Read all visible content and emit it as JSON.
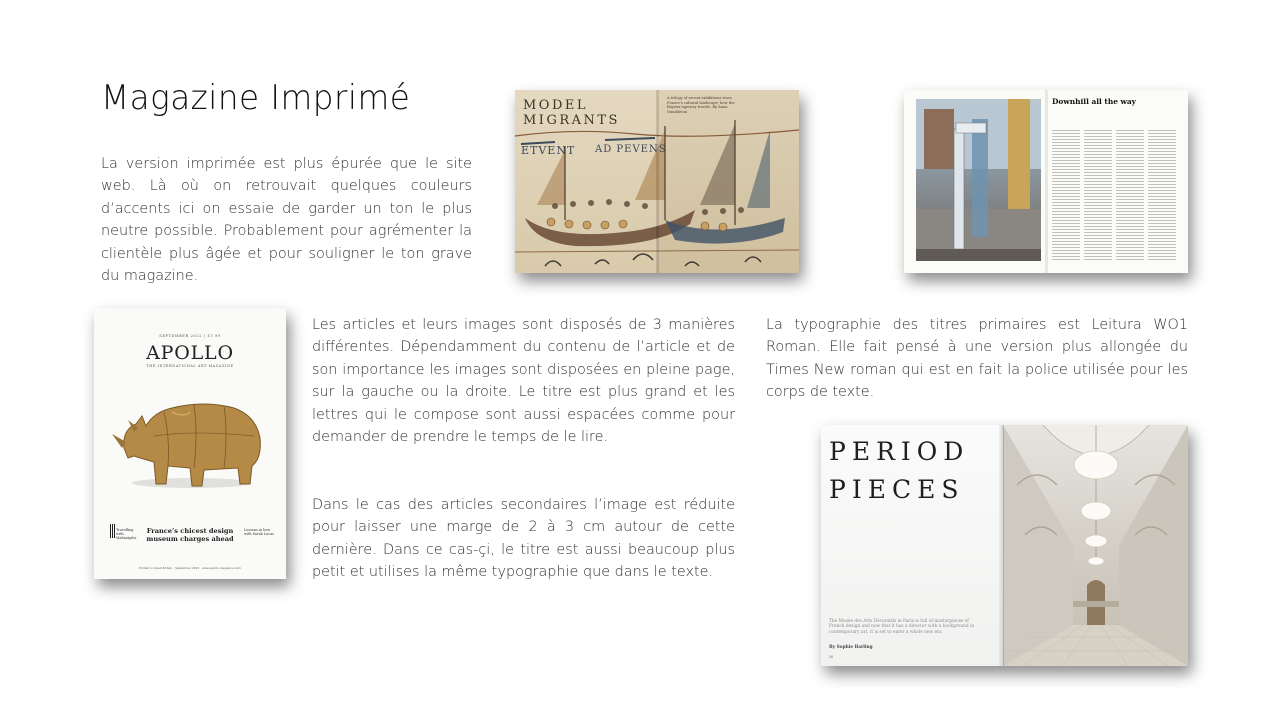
{
  "slide": {
    "title": "Magazine Imprimé",
    "paragraphs": {
      "intro": "La version imprimée est plus épurée que le site web. Là où on retrouvait quelques couleurs d’accents ici on essaie de garder un ton le plus neutre possible. Probablement pour agrémenter la clientèle plus âgée et pour souligner le ton grave du magazine.",
      "layouts": "Les articles et leurs images sont disposés de 3 manières différentes. Dépendamment du contenu de l’article et de son importance les images sont disposées en pleine page, sur la gauche ou la droite. Le titre est plus grand et les lettres qui le compose sont aussi espacées comme pour demander de prendre le temps de le lire.",
      "secondary": "Dans le cas des articles secondaires l’image est réduite pour laisser une marge de 2 à 3 cm autour de cette dernière. Dans ce cas-çi, le titre est aussi beaucoup plus petit et utilises la même typographie que dans le texte.",
      "typography": "La typographie des titres primaires est Leitura WO1 Roman. Elle fait pensé à une version plus allongée du Times New roman qui est en fait la police utilisée pour les  corps de texte."
    }
  },
  "images": {
    "spread_tapestry": {
      "heading": "MODEL\nMIGRANTS",
      "deck": "A trilogy of recent exhibitions trace France’s cultural landscape; how the Bayeux tapestry travels. By Anna Dumbleton"
    },
    "spread_downhill": {
      "heading": "Downhill all the way"
    },
    "cover": {
      "issue": "SEPTEMBER 2022 | £7.99",
      "brand": "APOLLO",
      "tagline": "THE INTERNATIONAL ART MAGAZINE",
      "headline": "France’s chicest design museum charges ahead",
      "side_left": "Travelling with Maharajahs",
      "side_right": "Lessons in love with Sarah Lucas",
      "footer": "Printed in Great Britain · September 2022 · www.apollo-magazine.com"
    },
    "spread_period": {
      "heading": "PERIOD\nPIECES",
      "intro": "The Musée des Arts Décoratifs in Paris is full of masterpieces of French design and now that it has a director with a background in contemporary art, it is set to enter a whole new era",
      "byline": "By Sophie Barling",
      "page": "30"
    }
  },
  "colors": {
    "text": "#333333",
    "title": "#111111",
    "background": "#ffffff"
  }
}
